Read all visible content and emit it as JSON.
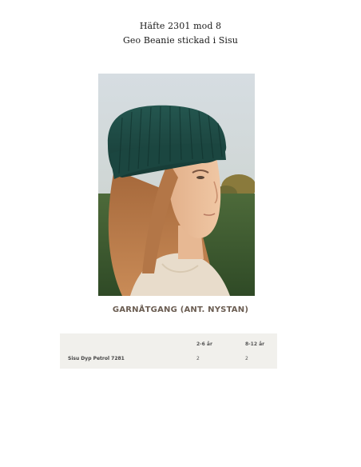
{
  "header": {
    "line1": "Häfte 2301 mod 8",
    "line2": "Geo Beanie stickad i Sisu"
  },
  "photo": {
    "description": "",
    "hat_color": "#1f4d46"
  },
  "yarn_section": {
    "heading": "GARNÅTGANG (ANT. NYSTAN)",
    "columns": [
      "",
      "2-6 år",
      "8-12 år"
    ],
    "rows": [
      {
        "name": "Sisu Dyp Petrol 7281",
        "values": [
          "2",
          "2"
        ]
      }
    ]
  },
  "colors": {
    "heading": "#6b5d52",
    "table_bg": "#f1f0ec"
  }
}
